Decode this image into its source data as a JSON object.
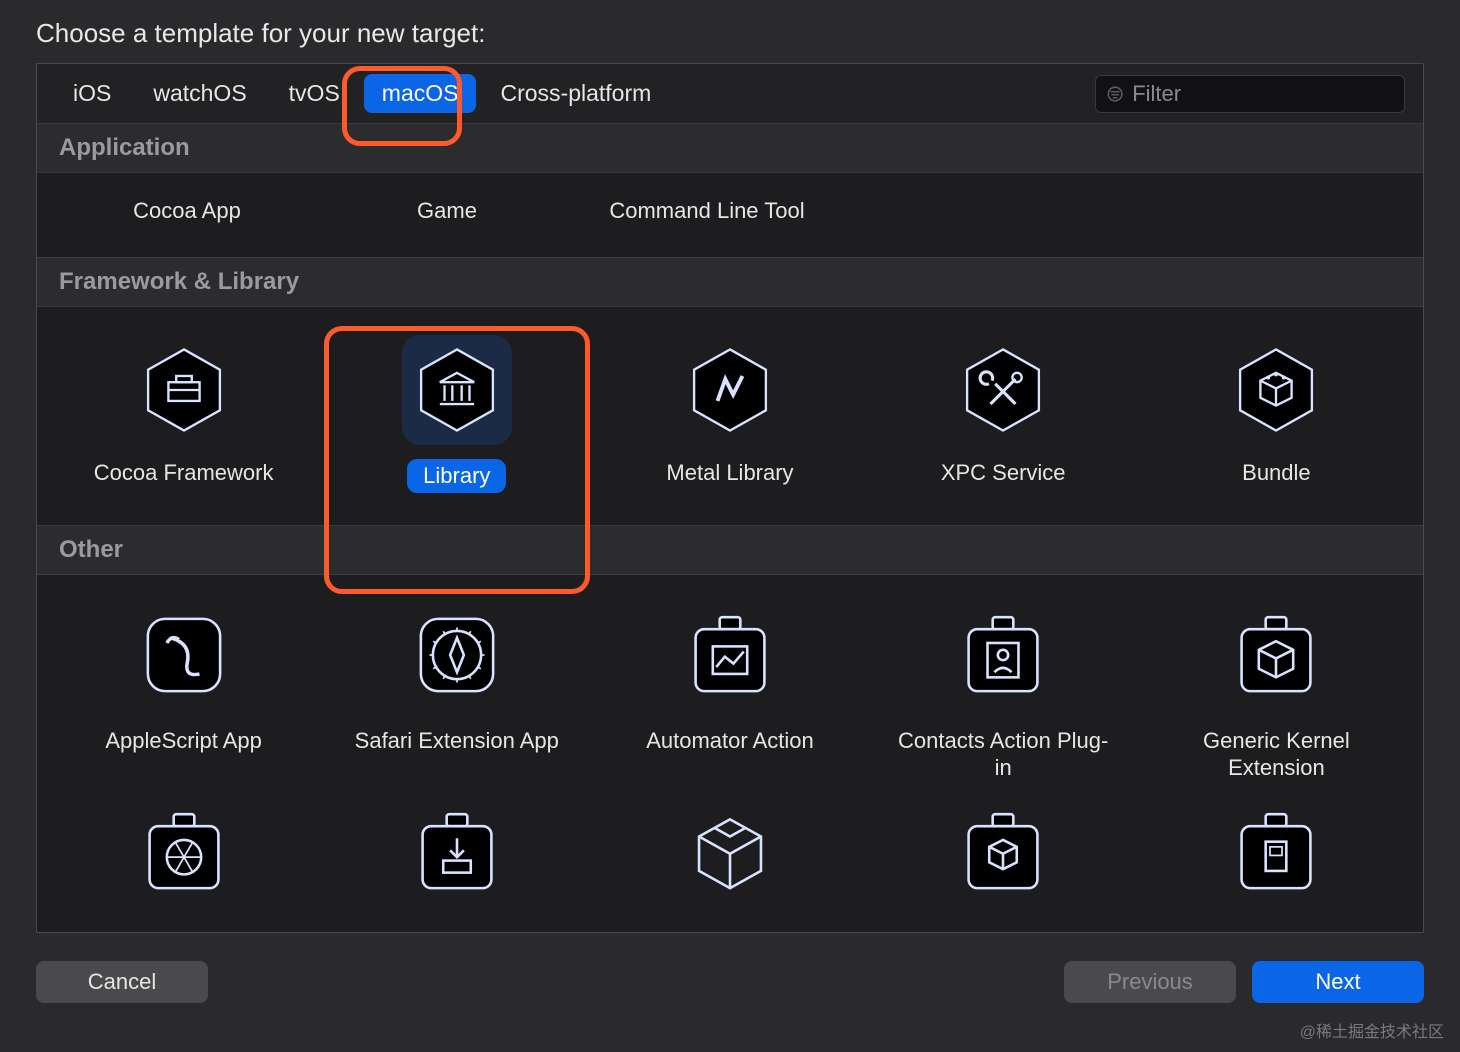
{
  "prompt": "Choose a template for your new target:",
  "tabs": {
    "items": [
      {
        "id": "ios",
        "label": "iOS",
        "active": false
      },
      {
        "id": "watch",
        "label": "watchOS",
        "active": false
      },
      {
        "id": "tvos",
        "label": "tvOS",
        "active": false
      },
      {
        "id": "macos",
        "label": "macOS",
        "active": true
      },
      {
        "id": "cross",
        "label": "Cross-platform",
        "active": false
      }
    ],
    "filter_placeholder": "Filter"
  },
  "sections": [
    {
      "title": "Application",
      "layout": "cols3",
      "show_icons": false,
      "items": [
        {
          "id": "cocoa-app",
          "label": "Cocoa App"
        },
        {
          "id": "game",
          "label": "Game"
        },
        {
          "id": "cli-tool",
          "label": "Command Line Tool"
        }
      ]
    },
    {
      "title": "Framework & Library",
      "layout": "cols5",
      "show_icons": true,
      "items": [
        {
          "id": "cocoa-framework",
          "label": "Cocoa Framework",
          "icon": "toolbox-icon",
          "selected": false
        },
        {
          "id": "library",
          "label": "Library",
          "icon": "library-icon",
          "selected": true
        },
        {
          "id": "metal-library",
          "label": "Metal Library",
          "icon": "metal-icon",
          "selected": false
        },
        {
          "id": "xpc-service",
          "label": "XPC Service",
          "icon": "tools-icon",
          "selected": false
        },
        {
          "id": "bundle",
          "label": "Bundle",
          "icon": "cube-icon",
          "selected": false
        }
      ]
    },
    {
      "title": "Other",
      "layout": "cols5",
      "show_icons": true,
      "items": [
        {
          "id": "applescript-app",
          "label": "AppleScript App",
          "icon": "scroll-icon"
        },
        {
          "id": "safari-ext-app",
          "label": "Safari Extension App",
          "icon": "compass-icon"
        },
        {
          "id": "automator-action",
          "label": "Automator Action",
          "icon": "chart-plugin-icon"
        },
        {
          "id": "contacts-plugin",
          "label": "Contacts Action Plug-in",
          "icon": "contact-plugin-icon"
        },
        {
          "id": "kernel-ext",
          "label": "Generic Kernel Extension",
          "icon": "cube-plugin-icon"
        },
        {
          "id": "other-6",
          "label": "",
          "icon": "aperture-plugin-icon"
        },
        {
          "id": "other-7",
          "label": "",
          "icon": "download-plugin-icon"
        },
        {
          "id": "other-8",
          "label": "",
          "icon": "package-icon"
        },
        {
          "id": "other-9",
          "label": "",
          "icon": "cube2-plugin-icon"
        },
        {
          "id": "other-10",
          "label": "",
          "icon": "window-plugin-icon"
        }
      ]
    }
  ],
  "footer": {
    "cancel": "Cancel",
    "previous": "Previous",
    "next": "Next"
  },
  "watermark": "@稀土掘金技术社区"
}
